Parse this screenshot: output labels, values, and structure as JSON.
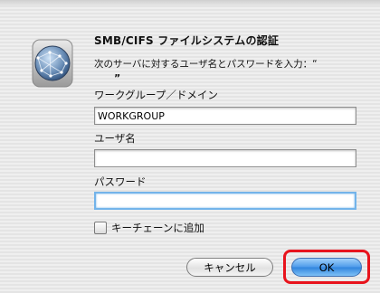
{
  "dialog": {
    "title": "SMB/CIFS ファイルシステムの認証",
    "prompt": "次のサーバに対するユーザ名とパスワードを入力：“",
    "prompt_server": "”",
    "workgroup_label": "ワークグループ／ドメイン",
    "workgroup_value": "WORKGROUP",
    "username_label": "ユーザ名",
    "username_value": "",
    "password_label": "パスワード",
    "password_value": "",
    "keychain_label": "キーチェーンに追加",
    "keychain_checked": false,
    "cancel_label": "キャンセル",
    "ok_label": "OK"
  },
  "icons": {
    "dialog_icon": "network-globe-icon"
  },
  "colors": {
    "highlight": "#e8141d",
    "default_button": "#4d9bea",
    "focus_ring": "#73b4ea"
  }
}
